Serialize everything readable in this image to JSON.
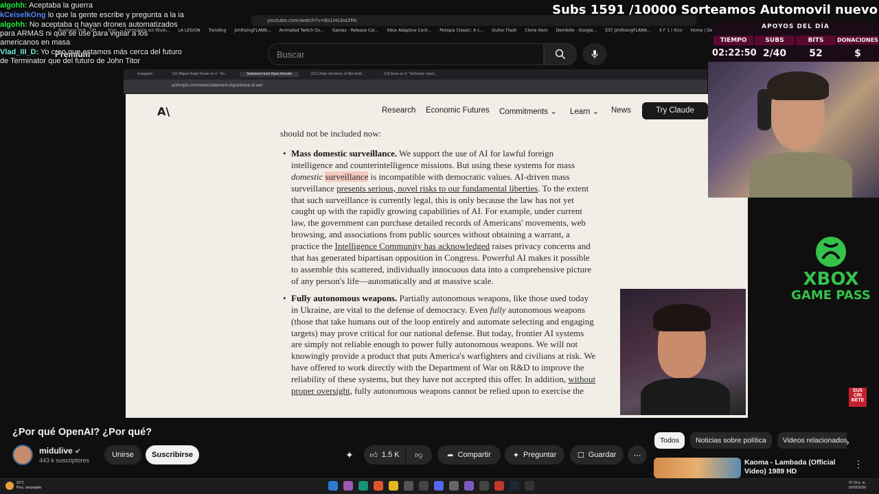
{
  "browser": {
    "url": "youtube.com/watch?v=Ko1Ho3oLYMc",
    "bookmarks": [
      "Business Hub - Ult...",
      "tryn",
      "Formulario sin título...",
      "LA LEGION",
      "Trending",
      "JimRisingFLANN...",
      "Animated Twitch Ov...",
      "Games - Release Cal...",
      "Xbox Adaptive Cont...",
      "Petopia Classic: A c...",
      "Guitar Flash",
      "Clone Hero",
      "Dembōle - Google...",
      "EST JimRisingFLANN...",
      "X F 1 | Xico",
      "Home | Demolke"
    ]
  },
  "youtube_header": {
    "logo": "Premium",
    "search_placeholder": "Buscar"
  },
  "chat": [
    {
      "user": "algohh:",
      "text": "Aceptaba la guerra",
      "color": "green"
    },
    {
      "user": "kCeiselkOng",
      "text": "lo que la gente escribe y pregunta a la ia",
      "color": "blue"
    },
    {
      "user": "algohh:",
      "text": "No aceptaba q hayan drones automatizados para ARMAS ni que se use para vigilar a los americanos en masa",
      "color": "green"
    },
    {
      "user": "Vlad_III_D:",
      "text": "Yo creo que estamos más cerca del futuro de Terminator que del futuro de John Titor",
      "color": "cyan"
    }
  ],
  "inner_browser": {
    "tabs": [
      {
        "label": "Instagram",
        "active": false
      },
      {
        "label": "(12) Miguel Ángel Durán en X: \"Un...",
        "active": false
      },
      {
        "label": "Statement from Dario Amodei",
        "active": true
      },
      {
        "label": "(12) Under Secretary of War Emil...",
        "active": false
      },
      {
        "label": "(13) Axios en X: \"Anthropic reject...",
        "active": false
      }
    ],
    "url": "anthropic.com/news/statement-department-of-war"
  },
  "site": {
    "logo": "A\\",
    "nav": [
      "Research",
      "Economic Futures",
      "Commitments",
      "Learn",
      "News"
    ],
    "cta": "Try Claude"
  },
  "article": {
    "lead": "should not be included now:",
    "bullet1": {
      "bold": "Mass domestic surveillance.",
      "t1": " We support the use of AI for lawful foreign intelligence and counterintelligence missions. But using these systems for mass ",
      "em": "domestic",
      "hl": "surveillance",
      "t2": " is incompatible with democratic values. AI-driven mass surveillance ",
      "link1": "presents serious, novel risks to our fundamental liberties",
      "t3": ". To the extent that such surveillance is currently legal, this is only because the law has not yet caught up with the rapidly growing capabilities of AI. For example, under current law, the government can purchase detailed records of Americans' movements, web browsing, and associations from public sources without obtaining a warrant, a practice the ",
      "link2": "Intelligence Community has acknowledged",
      "t4": " raises privacy concerns and that has generated bipartisan opposition in Congress. Powerful AI makes it possible to assemble this scattered, individually innocuous data into a comprehensive picture of any person's life—automatically and at massive scale."
    },
    "bullet2": {
      "bold": "Fully autonomous weapons.",
      "t1": " Partially autonomous weapons, like those used today in Ukraine, are vital to the defense of democracy. Even ",
      "em": "fully",
      "t2": " autonomous weapons (those that take humans out of the loop entirely and automate selecting and engaging targets) may prove critical for our national defense. But today, frontier AI systems are simply not reliable enough to power fully autonomous weapons. We will not knowingly provide a product that puts America's warfighters and civilians at risk. We have offered to work directly with the Department of War on R&D to improve the reliability of these systems, but they have not accepted this offer. In addition, ",
      "link1": "without proper oversight",
      "t3": ", fully autonomous weapons cannot be relied upon to exercise the"
    }
  },
  "stream_overlay": {
    "goal": "Subs 1591 /10000 Sorteamos Automovil nuevo",
    "stats_title": "APOYOS DEL DÍA",
    "headers": [
      "TIEMPO",
      "SUBS",
      "BITS",
      "DONACIONES"
    ],
    "values": [
      "02:22:50",
      "2/40",
      "52",
      "$"
    ],
    "xbox_line1": "XBOX",
    "xbox_line2": "GAME PASS",
    "sub_badge": "SUS CRI BETE"
  },
  "video": {
    "title": "¿Por qué OpenAI? ¿Por qué?",
    "channel": "midulive",
    "subscribers": "443 k suscriptores",
    "join": "Unirse",
    "subscribe": "Suscribirse",
    "likes": "1.5 K",
    "share": "Compartir",
    "ask": "Preguntar",
    "save": "Guardar"
  },
  "recommendations": {
    "chips": [
      "Todos",
      "Noticias sobre política",
      "Videos relacionados"
    ],
    "first_title": "Kaoma - Lambada (Official Video) 1989 HD"
  },
  "taskbar": {
    "temp": "22°C",
    "weather": "Prac. despejado",
    "time": "07:33 p. m.",
    "date": "02/03/2026"
  },
  "colors": {
    "accent_green": "#35c24a",
    "highlight": "#f3c9c0",
    "page_bg": "#f0eee6"
  }
}
